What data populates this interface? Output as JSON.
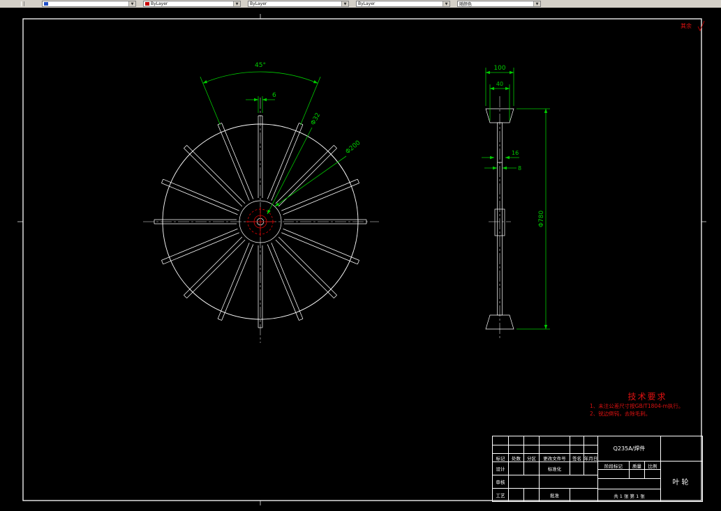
{
  "toolbar": {
    "combos": [
      "",
      "ByLayer",
      "ByLayer",
      "ByLayer",
      "随颜色"
    ]
  },
  "surface_note": "其余",
  "dims": {
    "angle": "45°",
    "width6": "6",
    "d32": "Φ32",
    "d200": "Φ200",
    "w100": "100",
    "w40": "40",
    "t16": "16",
    "t8": "8",
    "d780": "Φ780"
  },
  "tech_req": {
    "title": "技术要求",
    "line1": "1、未注公差尺寸按GB/T1804-m执行。",
    "line2": "2、锐边倒钝，去除毛刺。"
  },
  "title_block": {
    "material": "Q235A/焊件",
    "part_name": "叶轮",
    "header": [
      "标记",
      "处数",
      "分区",
      "更改文件号",
      "签名",
      "年月日"
    ],
    "design": "设计",
    "check": "审核",
    "process": "工艺",
    "standard": "标准化",
    "approve": "批准",
    "stage": [
      "阶段标记",
      "质量",
      "比例"
    ],
    "sheet_info": "共 1 张  第 1 张"
  }
}
